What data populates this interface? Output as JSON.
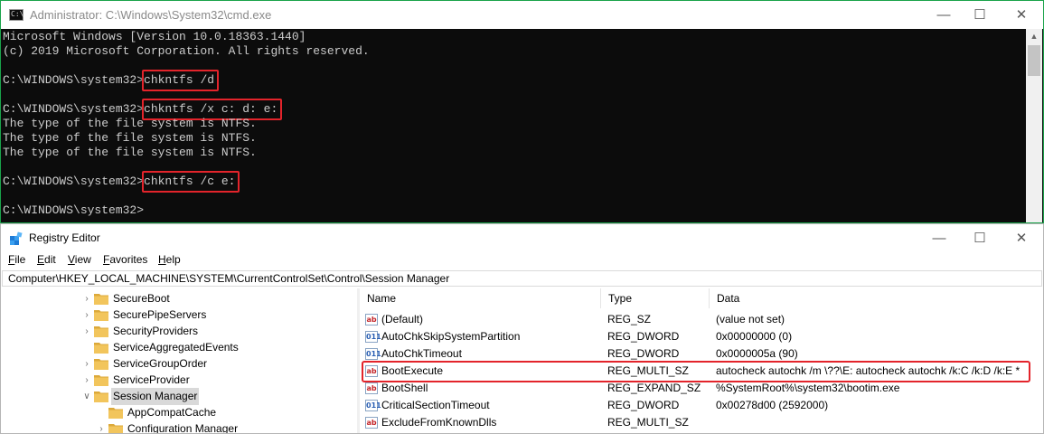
{
  "cmd": {
    "title": "Administrator: C:\\Windows\\System32\\cmd.exe",
    "icon": "C:\\",
    "lines": [
      {
        "text": "Microsoft Windows [Version 10.0.18363.1440]"
      },
      {
        "text": "(c) 2019 Microsoft Corporation. All rights reserved."
      },
      {
        "text": ""
      },
      {
        "prompt": "C:\\WINDOWS\\system32>",
        "command": "chkntfs /d",
        "highlight": true
      },
      {
        "text": ""
      },
      {
        "prompt": "C:\\WINDOWS\\system32>",
        "command": "chkntfs /x c: d: e:",
        "highlight": true
      },
      {
        "text": "The type of the file system is NTFS."
      },
      {
        "text": "The type of the file system is NTFS."
      },
      {
        "text": "The type of the file system is NTFS."
      },
      {
        "text": ""
      },
      {
        "prompt": "C:\\WINDOWS\\system32>",
        "command": "chkntfs /c e:",
        "highlight": true
      },
      {
        "text": ""
      },
      {
        "prompt": "C:\\WINDOWS\\system32>"
      }
    ]
  },
  "regedit": {
    "title": "Registry Editor",
    "menu": [
      {
        "label": "File",
        "accel": "F",
        "rest": "ile"
      },
      {
        "label": "Edit",
        "accel": "E",
        "rest": "dit"
      },
      {
        "label": "View",
        "accel": "V",
        "rest": "iew"
      },
      {
        "label": "Favorites",
        "accel": "F",
        "rest": "avorites"
      },
      {
        "label": "Help",
        "accel": "H",
        "rest": "elp"
      }
    ],
    "address": "Computer\\HKEY_LOCAL_MACHINE\\SYSTEM\\CurrentControlSet\\Control\\Session Manager",
    "tree": [
      {
        "label": "SecureBoot",
        "level": 0,
        "expand": "collapsed"
      },
      {
        "label": "SecurePipeServers",
        "level": 0,
        "expand": "collapsed"
      },
      {
        "label": "SecurityProviders",
        "level": 0,
        "expand": "collapsed"
      },
      {
        "label": "ServiceAggregatedEvents",
        "level": 0,
        "expand": "none"
      },
      {
        "label": "ServiceGroupOrder",
        "level": 0,
        "expand": "collapsed"
      },
      {
        "label": "ServiceProvider",
        "level": 0,
        "expand": "collapsed"
      },
      {
        "label": "Session Manager",
        "level": 0,
        "expand": "expanded",
        "selected": true
      },
      {
        "label": "AppCompatCache",
        "level": 1,
        "expand": "none"
      },
      {
        "label": "Configuration Manager",
        "level": 1,
        "expand": "collapsed"
      }
    ],
    "columns": [
      "Name",
      "Type",
      "Data"
    ],
    "values": [
      {
        "name": "(Default)",
        "type": "REG_SZ",
        "data": "(value not set)",
        "kind": "sz"
      },
      {
        "name": "AutoChkSkipSystemPartition",
        "type": "REG_DWORD",
        "data": "0x00000000 (0)",
        "kind": "dword"
      },
      {
        "name": "AutoChkTimeout",
        "type": "REG_DWORD",
        "data": "0x0000005a (90)",
        "kind": "dword"
      },
      {
        "name": "BootExecute",
        "type": "REG_MULTI_SZ",
        "data": "autocheck autochk /m \\??\\E: autocheck autochk /k:C /k:D /k:E *",
        "kind": "sz",
        "highlight": true
      },
      {
        "name": "BootShell",
        "type": "REG_EXPAND_SZ",
        "data": "%SystemRoot%\\system32\\bootim.exe",
        "kind": "sz"
      },
      {
        "name": "CriticalSectionTimeout",
        "type": "REG_DWORD",
        "data": "0x00278d00 (2592000)",
        "kind": "dword"
      },
      {
        "name": "ExcludeFromKnownDlls",
        "type": "REG_MULTI_SZ",
        "data": "",
        "kind": "sz"
      }
    ]
  },
  "colors": {
    "highlight": "#e3242b",
    "console_bg": "#0c0c0c",
    "console_text": "#cccccc",
    "folder": "#f2c55c"
  },
  "icons": {
    "minimize": "minimize-icon",
    "maximize": "maximize-icon",
    "close": "close-icon",
    "folder": "folder-icon",
    "string_value": "string-value-icon",
    "dword_value": "binary-value-icon"
  }
}
